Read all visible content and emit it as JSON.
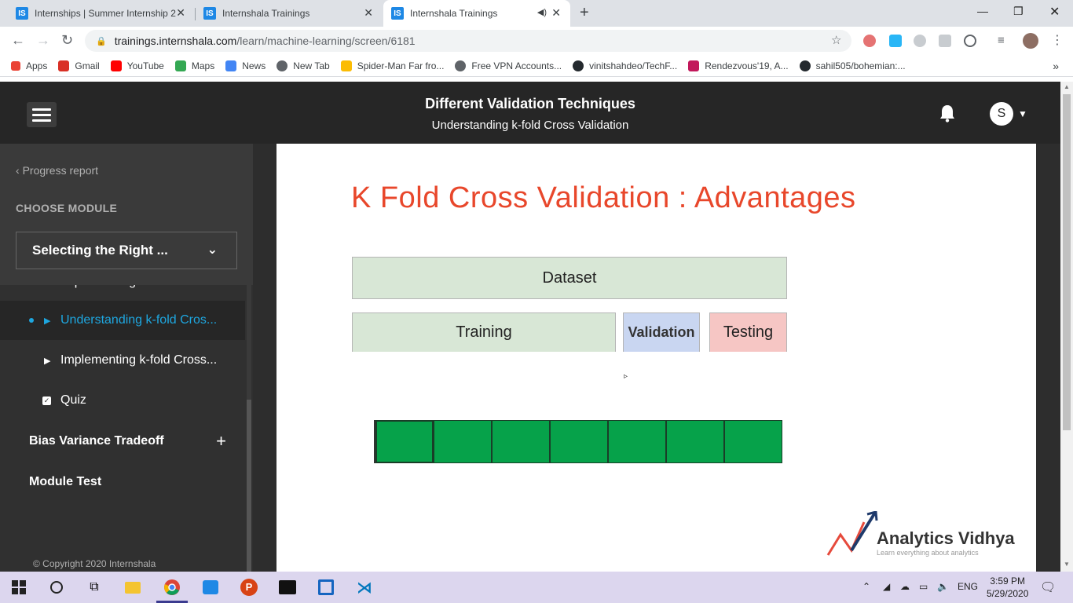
{
  "browser": {
    "tabs": [
      {
        "title": "Internships | Summer Internship 2",
        "active": false
      },
      {
        "title": "Internshala Trainings",
        "active": false
      },
      {
        "title": "Internshala Trainings",
        "active": true
      }
    ],
    "favicon_text": "IS",
    "url_host": "trainings.internshala.com",
    "url_path": "/learn/machine-learning/screen/6181",
    "bookmarks": [
      {
        "label": "Apps",
        "color": "#e94335"
      },
      {
        "label": "Gmail",
        "color": "#d93025"
      },
      {
        "label": "YouTube",
        "color": "#ff0000"
      },
      {
        "label": "Maps",
        "color": "#34a853"
      },
      {
        "label": "News",
        "color": "#4285f4"
      },
      {
        "label": "New Tab",
        "color": "#5f6368"
      },
      {
        "label": "Spider-Man Far fro...",
        "color": "#fbbc04"
      },
      {
        "label": "Free VPN Accounts...",
        "color": "#5f6368"
      },
      {
        "label": "vinitshahdeo/TechF...",
        "color": "#24292e"
      },
      {
        "label": "Rendezvous'19, A...",
        "color": "#c2185b"
      },
      {
        "label": "sahil505/bohemian:...",
        "color": "#24292e"
      }
    ]
  },
  "header": {
    "title": "Different Validation Techniques",
    "subtitle": "Understanding k-fold Cross Validation",
    "avatar_letter": "S"
  },
  "sidebar": {
    "progress_report": "Progress report",
    "choose_module": "CHOOSE MODULE",
    "module_selected": "Selecting the Right ...",
    "lessons": [
      {
        "label": "Understanding k-fold Cros...",
        "active": true,
        "type": "video"
      },
      {
        "label": "Implementing k-fold Cross...",
        "active": false,
        "type": "video"
      },
      {
        "label": "Quiz",
        "active": false,
        "type": "quiz"
      }
    ],
    "sections": [
      {
        "label": "Bias Variance Tradeoff",
        "expandable": true
      },
      {
        "label": "Module Test",
        "expandable": false
      }
    ],
    "copyright": "© Copyright 2020 Internshala"
  },
  "slide": {
    "title": "K Fold Cross Validation : Advantages",
    "dataset_label": "Dataset",
    "training_label": "Training",
    "validation_label": "Validation",
    "testing_label": "Testing",
    "fold_count": 7,
    "logo_name": "Analytics Vidhya",
    "logo_tagline": "Learn everything about analytics",
    "colors": {
      "title": "#e8472b",
      "fold": "#06a24a",
      "dataset": "#d8e7d6",
      "validation": "#c9d6f1",
      "testing": "#f6c6c4"
    }
  },
  "taskbar": {
    "language": "ENG",
    "time": "3:59 PM",
    "date": "5/29/2020"
  }
}
